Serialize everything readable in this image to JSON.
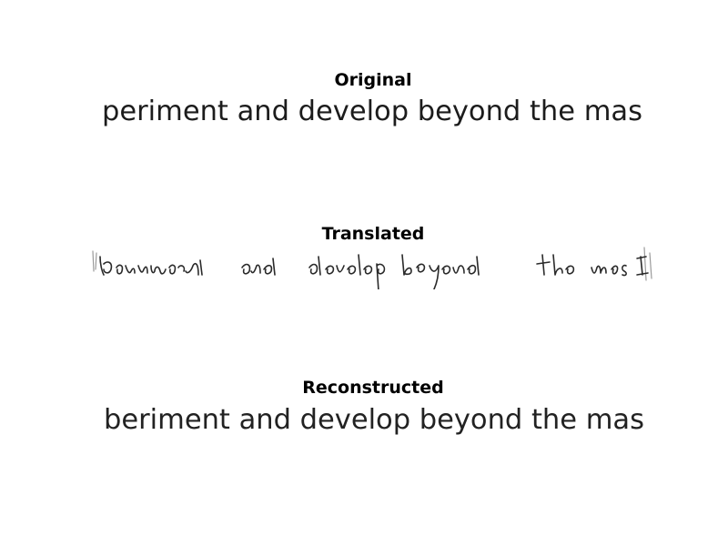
{
  "panels": {
    "original": {
      "title": "Original",
      "text": "periment and  develop beyond the mas"
    },
    "translated": {
      "title": "Translated",
      "text": "periment and develop beyond the mas"
    },
    "reconstructed": {
      "title": "Reconstructed",
      "text": "beriment and  develop beyond the mas"
    }
  }
}
